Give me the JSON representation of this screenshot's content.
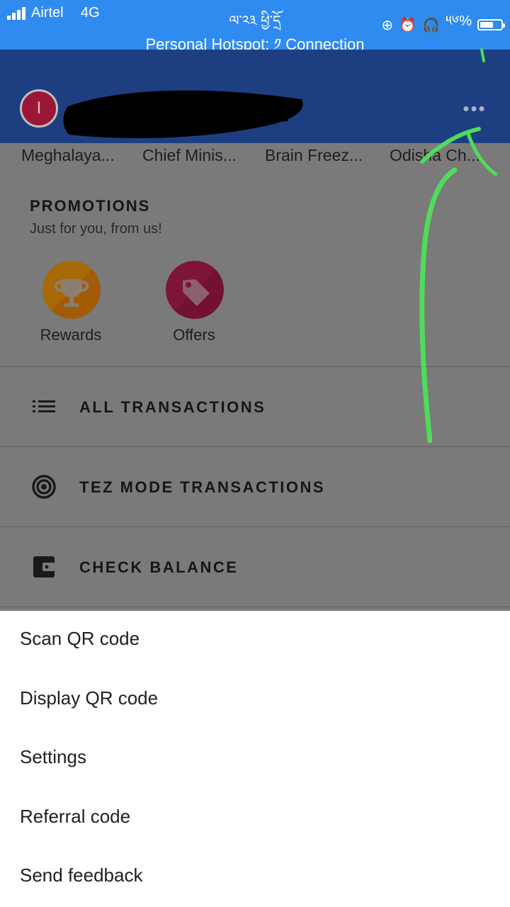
{
  "status_bar": {
    "carrier": "Airtel",
    "network": "4G",
    "center_text": "ལ་༢༣ ཕྱི་དྲོ",
    "battery_text": "༥༦%",
    "hotspot_text": "Personal Hotspot: ༡ Connection",
    "color": "#2f8bf0"
  },
  "header": {
    "avatar_initial": "I",
    "more_icon": "more-horizontal-icon",
    "color": "#1d3f82"
  },
  "people_chips": [
    "Meghalaya...",
    "Chief Minis...",
    "Brain Freez...",
    "Odisha Ch..."
  ],
  "promotions": {
    "title": "PROMOTIONS",
    "subtitle": "Just for you, from us!",
    "items": [
      {
        "label": "Rewards",
        "icon": "trophy-icon"
      },
      {
        "label": "Offers",
        "icon": "tag-icon"
      }
    ]
  },
  "actions": [
    {
      "label": "ALL TRANSACTIONS",
      "icon": "list-icon"
    },
    {
      "label": "TEZ MODE TRANSACTIONS",
      "icon": "target-icon"
    },
    {
      "label": "CHECK BALANCE",
      "icon": "wallet-icon"
    }
  ],
  "menu": {
    "items": [
      "Scan QR code",
      "Display QR code",
      "Settings",
      "Referral code",
      "Send feedback"
    ]
  },
  "annotation_color": "#4fdc5a"
}
